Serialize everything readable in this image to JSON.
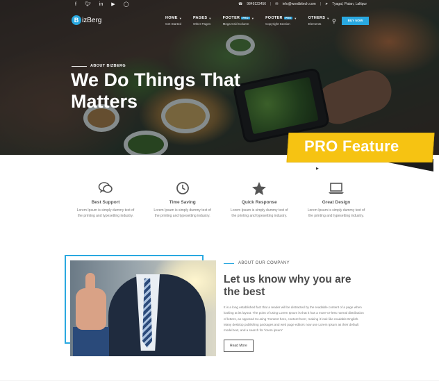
{
  "topbar": {
    "social_icons": [
      "facebook-icon",
      "twitter-icon",
      "linkedin-icon",
      "youtube-icon",
      "instagram-icon"
    ],
    "phone": "9849123456",
    "email": "info@wordbitech.com",
    "address": "Tyagal, Patan, Lalitpur"
  },
  "nav": {
    "logo_letter": "B",
    "logo_text": "izBerg",
    "items": [
      {
        "label": "HOME",
        "sub": "Get Started",
        "pro": ""
      },
      {
        "label": "PAGES",
        "sub": "Other Pages",
        "pro": ""
      },
      {
        "label": "FOOTER",
        "sub": "Mega Grid Column",
        "pro": "PRO"
      },
      {
        "label": "FOOTER",
        "sub": "Copyright Section",
        "pro": "PRO"
      },
      {
        "label": "OTHERS",
        "sub": "Elements",
        "pro": ""
      }
    ],
    "buy_label": "BUY NOW"
  },
  "hero": {
    "eyebrow": "ABOUT BIZBERG",
    "title": "We Do Things That Matters"
  },
  "pro_banner": {
    "label": "PRO Feature"
  },
  "features": [
    {
      "icon": "chat-icon",
      "title": "Best Support",
      "desc": "Lorem Ipsum is simply dummy text of the printing and typesetting industry."
    },
    {
      "icon": "clock-icon",
      "title": "Time Saving",
      "desc": "Lorem Ipsum is simply dummy text of the printing and typesetting industry."
    },
    {
      "icon": "star-icon",
      "title": "Quick Response",
      "desc": "Lorem Ipsum is simply dummy text of the printing and typesetting industry."
    },
    {
      "icon": "laptop-icon",
      "title": "Great Design",
      "desc": "Lorem Ipsum is simply dummy text of the printing and typesetting industry."
    }
  ],
  "about": {
    "eyebrow": "ABOUT OUR COMPANY",
    "title": "Let us know why you are the best",
    "body": "It is a long established fact that a reader will be distracted by the readable content of a page when looking at its layout. The point of using Lorem Ipsum is that it has a more-or-less normal distribution of letters, as opposed to using 'Content here, content here', making it look like readable English. Many desktop publishing packages and web page editors now use Lorem Ipsum as their default model text, and a search for 'lorem ipsum'",
    "button": "Read More"
  },
  "colors": {
    "accent": "#29a8e0",
    "banner": "#f6c312"
  }
}
